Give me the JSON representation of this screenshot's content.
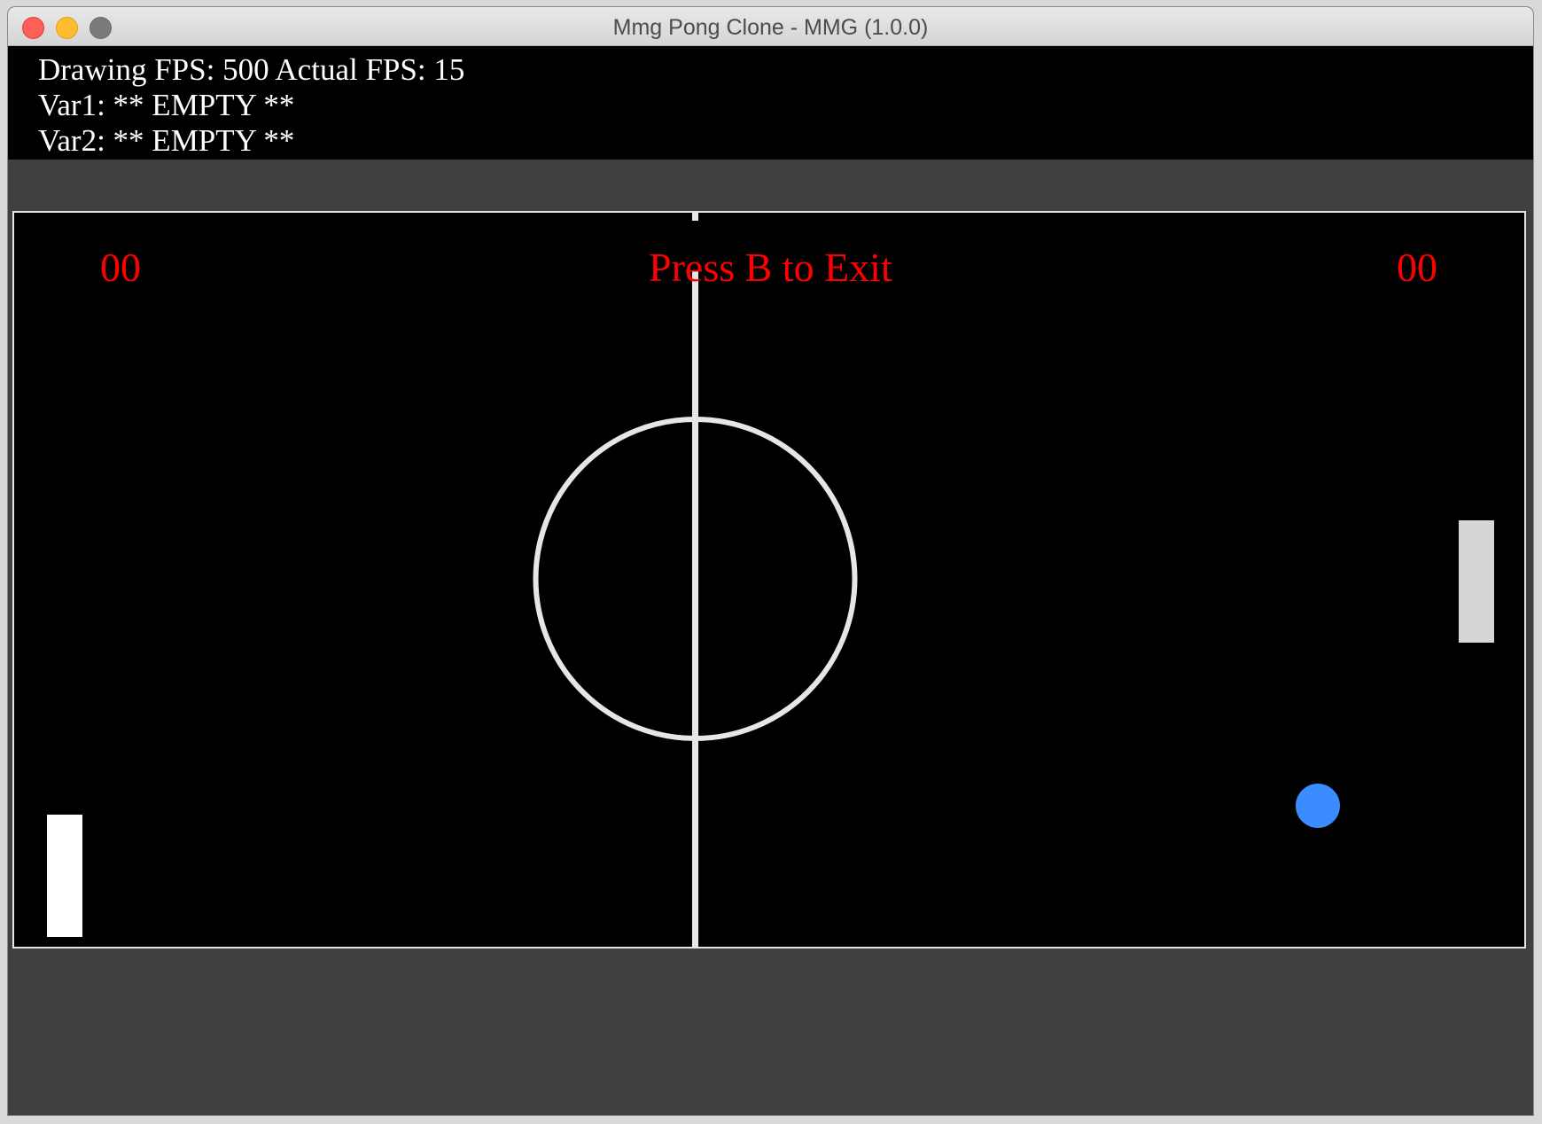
{
  "window": {
    "title": "Mmg Pong Clone - MMG (1.0.0)"
  },
  "debug": {
    "line1": "Drawing FPS: 500 Actual FPS: 15",
    "line2": "Var1: ** EMPTY **",
    "line3": "Var2: ** EMPTY **"
  },
  "game": {
    "score_left": "00",
    "score_right": "00",
    "hint": "Press B to Exit"
  },
  "colors": {
    "field_background": "#000000",
    "field_lines": "#e6e6e6",
    "score_text": "#ff0000",
    "ball": "#3a8cff",
    "left_paddle": "#ffffff",
    "right_paddle": "#d6d6d6"
  },
  "icons": {
    "close": "close-icon",
    "minimize": "minimize-icon",
    "zoom": "zoom-icon"
  }
}
